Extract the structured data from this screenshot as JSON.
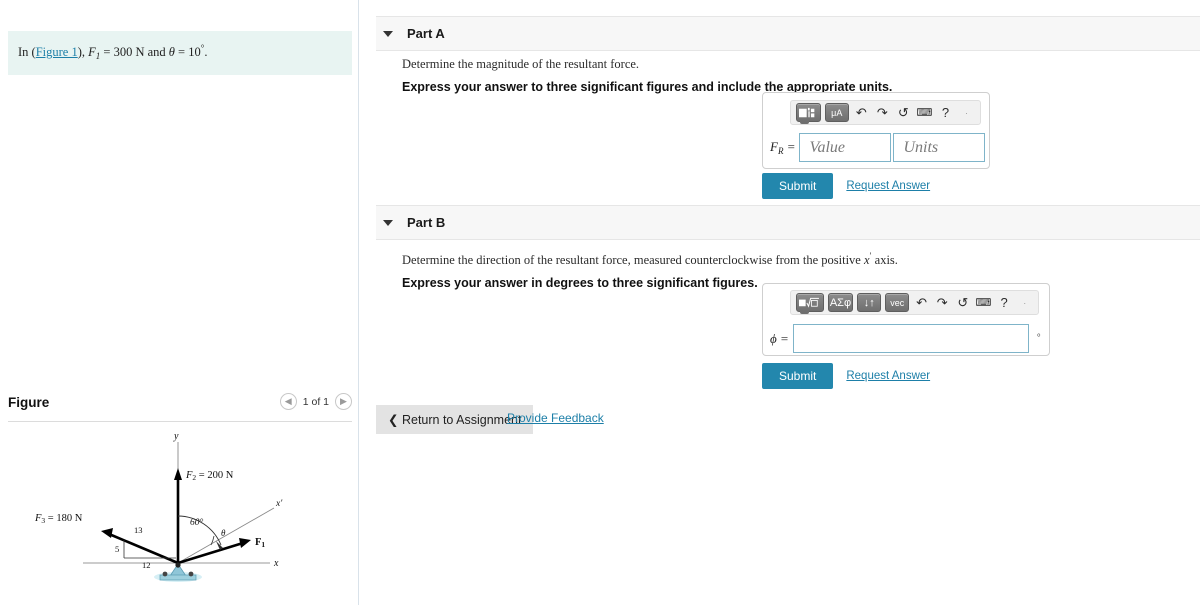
{
  "question": {
    "prefix": "In (",
    "figure_link": "Figure 1",
    "middle": "), ",
    "f1_symbol": "F",
    "f1_sub": "1",
    "f1_value": " = 300 N and ",
    "theta_symbol": "θ",
    "theta_value": " = 10",
    "degree": "°",
    "period": ".",
    "full_text": "In (Figure 1), F1 = 300 N and θ = 10°."
  },
  "figure_panel": {
    "title": "Figure",
    "prev_icon": "chevron-left-icon",
    "next_icon": "chevron-right-icon",
    "counter": "1 of 1"
  },
  "figure_diagram": {
    "y_axis_label": "y",
    "x_axis_label": "x",
    "x_prime_label": "x'",
    "f2_label": "F₂ = 200 N",
    "f3_label": "F₃ = 180 N",
    "f1_label": "F₁",
    "angle_60": "60°",
    "angle_theta": "θ",
    "triangle_hyp": "13",
    "triangle_vert": "5",
    "triangle_horiz": "12",
    "support_color": "#a9d3e0"
  },
  "parts": [
    {
      "id": "part-a",
      "label": "Part A",
      "caret_icon": "chevron-down-icon",
      "prompt": "Determine the magnitude of the resultant force.",
      "instruction": "Express your answer to three significant figures and include the appropriate units.",
      "toolbar": [
        {
          "name": "template-icon",
          "glyph": "■⬜",
          "type": "button"
        },
        {
          "name": "units-micro-amp-icon",
          "glyph": "μA",
          "type": "button"
        },
        {
          "name": "undo-icon",
          "glyph": "↶",
          "type": "icon"
        },
        {
          "name": "redo-icon",
          "glyph": "↷",
          "type": "icon"
        },
        {
          "name": "reset-icon",
          "glyph": "↺",
          "type": "icon"
        },
        {
          "name": "keyboard-icon",
          "glyph": "⌨",
          "type": "icon"
        },
        {
          "name": "help-icon",
          "glyph": "?",
          "type": "icon"
        },
        {
          "name": "overflow-icon",
          "glyph": "·",
          "type": "dot"
        }
      ],
      "field_label": "F",
      "field_label_sub": "R",
      "field_label_eq": " =",
      "value_placeholder": "Value",
      "units_placeholder": "Units",
      "submit_label": "Submit",
      "request_answer_label": "Request Answer"
    },
    {
      "id": "part-b",
      "label": "Part B",
      "caret_icon": "chevron-down-icon",
      "prompt_a": "Determine the direction of the resultant force, measured counterclockwise from the positive ",
      "prompt_x": "x",
      "prompt_prime": "′",
      "prompt_b": " axis.",
      "instruction": "Express your answer in degrees to three significant figures.",
      "toolbar": [
        {
          "name": "sqrt-template-icon",
          "glyph": "■√□",
          "type": "button"
        },
        {
          "name": "greek-letters-icon",
          "glyph": "ΑΣφ",
          "type": "button"
        },
        {
          "name": "arrows-updown-icon",
          "glyph": "↓↑",
          "type": "button"
        },
        {
          "name": "vector-icon",
          "glyph": "vec",
          "type": "button"
        },
        {
          "name": "undo-icon",
          "glyph": "↶",
          "type": "icon"
        },
        {
          "name": "redo-icon",
          "glyph": "↷",
          "type": "icon"
        },
        {
          "name": "reset-icon",
          "glyph": "↺",
          "type": "icon"
        },
        {
          "name": "keyboard-icon",
          "glyph": "⌨",
          "type": "icon"
        },
        {
          "name": "help-icon",
          "glyph": "?",
          "type": "icon"
        },
        {
          "name": "overflow-icon",
          "glyph": "·",
          "type": "dot"
        }
      ],
      "field_label": "ϕ",
      "field_label_eq": " =",
      "field_value": "",
      "unit_suffix": "°",
      "submit_label": "Submit",
      "request_answer_label": "Request Answer"
    }
  ],
  "footer": {
    "return_icon": "chevron-left-icon",
    "return_label": "Return to Assignment",
    "feedback_label": "Provide Feedback"
  },
  "colors": {
    "accent": "#2387ad",
    "link": "#1d7fa8",
    "question_bg": "#e8f4f2",
    "header_bg": "#f7f7f7",
    "input_border": "#7fb4c9"
  }
}
